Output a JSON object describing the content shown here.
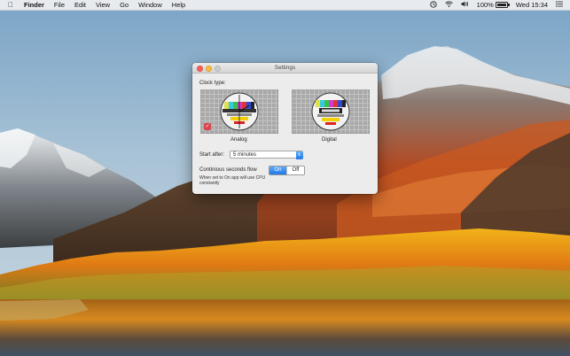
{
  "menubar": {
    "apple_icon": "apple-icon",
    "items": [
      "Finder",
      "File",
      "Edit",
      "View",
      "Go",
      "Window",
      "Help"
    ],
    "battery_percent": "100%",
    "battery_level": 1.0,
    "clock": "Wed 15:34",
    "status_icons": [
      "clock-icon",
      "wifi-icon",
      "volume-icon",
      "notification-center-icon"
    ]
  },
  "window": {
    "title": "Settings",
    "clock_type_label": "Clock type:",
    "options": [
      {
        "label": "Analog",
        "selected": true
      },
      {
        "label": "Digital",
        "selected": false
      }
    ],
    "start_after_label": "Start after:",
    "start_after_value": "5 minutes",
    "continuous_label": "Continious seconds flow",
    "toggle_on": "On",
    "toggle_off": "Off",
    "note": "When set to On app will use CPU constantly"
  },
  "colors": {
    "accent": "#1f79e6",
    "selection_check": "#d9434b",
    "close_button": "#fc605c",
    "minimize_button": "#fdbc40"
  }
}
